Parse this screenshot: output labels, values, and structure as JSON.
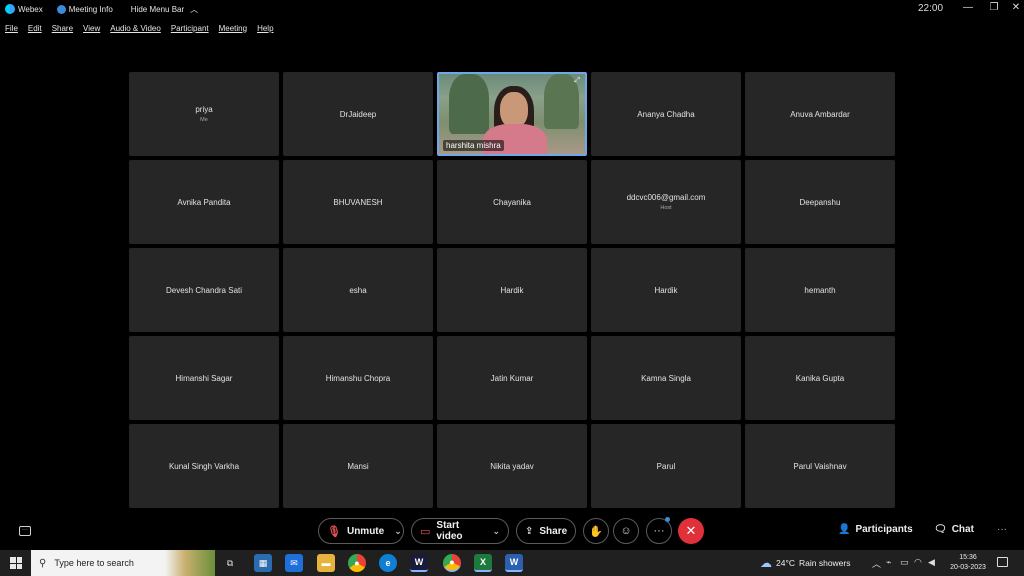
{
  "titlebar": {
    "app_name": "Webex",
    "meeting_info": "Meeting Info",
    "hide_menu": "Hide Menu Bar",
    "clock": "22:00"
  },
  "menu": [
    "File",
    "Edit",
    "Share",
    "View",
    "Audio & Video",
    "Participant",
    "Meeting",
    "Help"
  ],
  "participants": [
    {
      "name": "priya",
      "role": "Me"
    },
    {
      "name": "DrJaideep",
      "role": ""
    },
    {
      "name": "harshita mishra",
      "role": "",
      "video": true
    },
    {
      "name": "Ananya Chadha",
      "role": ""
    },
    {
      "name": "Anuva Ambardar",
      "role": ""
    },
    {
      "name": "Avnika Pandita",
      "role": ""
    },
    {
      "name": "BHUVANESH",
      "role": ""
    },
    {
      "name": "Chayanika",
      "role": ""
    },
    {
      "name": "ddcvc006@gmail.com",
      "role": "Host"
    },
    {
      "name": "Deepanshu",
      "role": ""
    },
    {
      "name": "Devesh Chandra Sati",
      "role": ""
    },
    {
      "name": "esha",
      "role": ""
    },
    {
      "name": "Hardik",
      "role": ""
    },
    {
      "name": "Hardik",
      "role": ""
    },
    {
      "name": "hemanth",
      "role": ""
    },
    {
      "name": "Himanshi Sagar",
      "role": ""
    },
    {
      "name": "Himanshu Chopra",
      "role": ""
    },
    {
      "name": "Jatin Kumar",
      "role": ""
    },
    {
      "name": "Kamna Singla",
      "role": ""
    },
    {
      "name": "Kanika Gupta",
      "role": ""
    },
    {
      "name": "Kunal Singh Varkha",
      "role": ""
    },
    {
      "name": "Mansi",
      "role": ""
    },
    {
      "name": "Nikita yadav",
      "role": ""
    },
    {
      "name": "Parul",
      "role": ""
    },
    {
      "name": "Parul Vaishnav",
      "role": ""
    }
  ],
  "controls": {
    "unmute": "Unmute",
    "start_video": "Start video",
    "share": "Share",
    "participants": "Participants",
    "chat": "Chat"
  },
  "taskbar": {
    "search_placeholder": "Type here to search",
    "weather_temp": "24°C",
    "weather_desc": "Rain showers",
    "time": "15:36",
    "date": "20-03-2023"
  },
  "colors": {
    "end_call": "#e0303a",
    "muted": "#e05050",
    "accent": "#3b8bd8"
  }
}
